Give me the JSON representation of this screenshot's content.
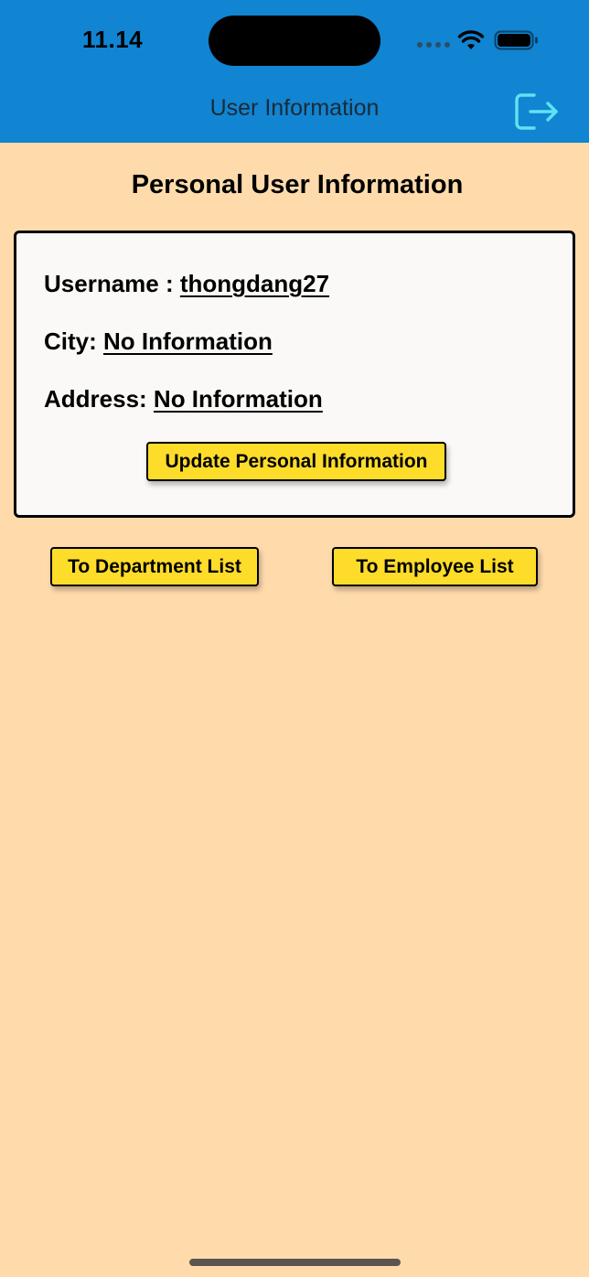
{
  "status_bar": {
    "time": "11.14"
  },
  "nav": {
    "title": "User Information",
    "logout_icon": "logout-icon"
  },
  "page": {
    "section_title": "Personal User Information"
  },
  "info": {
    "username_label": "Username : ",
    "username_value": " thongdang27",
    "city_label": "City: ",
    "city_value": " No Information",
    "address_label": "Address: ",
    "address_value": " No Information"
  },
  "actions": {
    "update_label": "Update Personal Information",
    "department_label": "To Department List",
    "employee_label": "To Employee List"
  },
  "colors": {
    "header": "#1184D2",
    "background": "#FFDBAC",
    "card": "#FAF9F7",
    "button": "#FEDC2A",
    "logout_icon": "#5FE3F2"
  }
}
